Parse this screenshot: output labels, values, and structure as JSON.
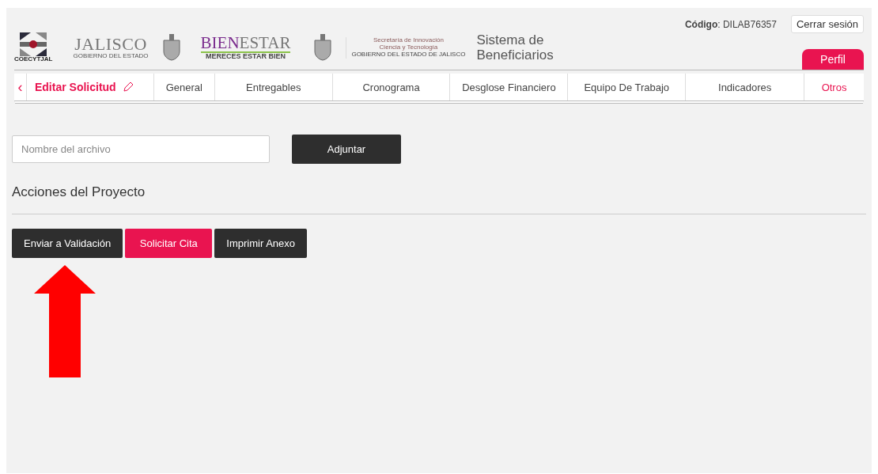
{
  "header": {
    "logos": {
      "coecytjal": "COECYTJAL",
      "jalisco": "JALISCO",
      "jalisco_sub": "GOBIERNO DEL ESTADO",
      "bienestar_a": "BIEN",
      "bienestar_b": "ESTAR",
      "bienestar_sub": "MERECES ESTAR BIEN",
      "secretaria": "Secretaría de Innovación",
      "secretaria_2": "Ciencia y Tecnología",
      "secretaria_sub": "GOBIERNO DEL ESTADO DE JALISCO"
    },
    "app_title": "Sistema de Beneficiarios",
    "code": "**Código**: DILAB76357",
    "logout": "Cerrar sesión",
    "profile_tab": "Perfil"
  },
  "nav": {
    "back": "‹",
    "title": "Editar Solicitud",
    "tabs": [
      {
        "label": "General",
        "selected": false
      },
      {
        "label": "Entregables",
        "selected": false
      },
      {
        "label": "Cronograma",
        "selected": false
      },
      {
        "label": "Desglose Financiero",
        "selected": false
      },
      {
        "label": "Equipo De Trabajo",
        "selected": false
      },
      {
        "label": "Indicadores",
        "selected": false
      },
      {
        "label": "Otros",
        "selected": true
      }
    ]
  },
  "upload": {
    "placeholder": "Nombre del archivo",
    "button": "Adjuntar"
  },
  "actions": {
    "title": "Acciones del Proyecto",
    "buttons": [
      {
        "label": "Enviar a Validación",
        "kind": "dark"
      },
      {
        "label": "Solicitar Cita",
        "kind": "accent"
      },
      {
        "label": "Imprimir Anexo",
        "kind": "dark"
      }
    ]
  }
}
